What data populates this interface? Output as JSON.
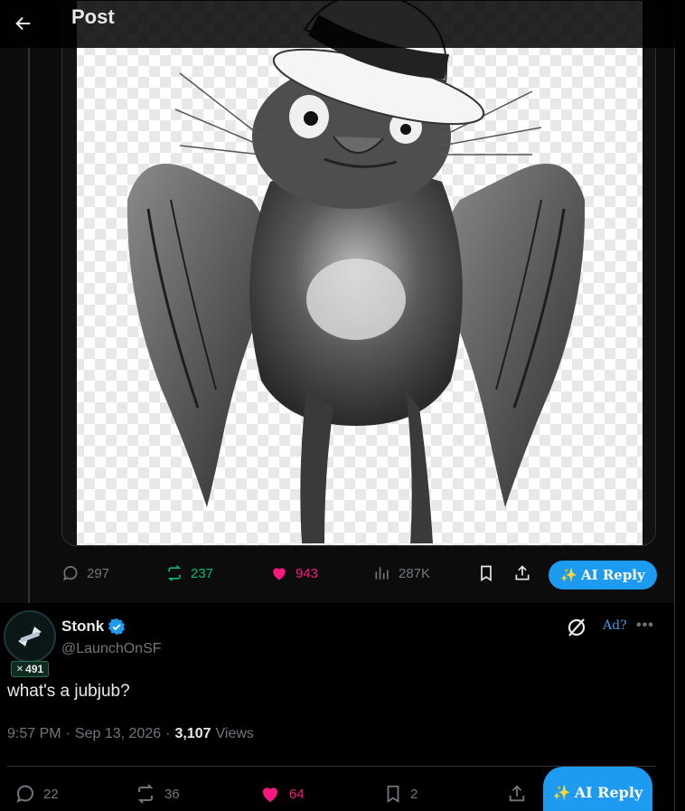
{
  "header": {
    "title": "Post"
  },
  "quoted_post": {
    "actions": {
      "replies": "297",
      "reposts": "237",
      "likes": "943",
      "views": "287K"
    },
    "ai_reply_label": "AI Reply"
  },
  "post": {
    "display_name": "Stonk",
    "handle": "@LaunchOnSF",
    "badge_count": "491",
    "ad_label": "Ad?",
    "text": "what's a jubjub?",
    "time": "9:57 PM",
    "date": "Sep 13, 2026",
    "views_count": "3,107",
    "views_label": "Views",
    "actions": {
      "replies": "22",
      "reposts": "36",
      "likes": "64",
      "bookmarks": "2"
    },
    "ai_reply_label": "AI Reply"
  },
  "colors": {
    "accent": "#1d9bf0",
    "repost_active": "#00ba7c",
    "like_active": "#f91880",
    "muted": "#71767b"
  },
  "icons": [
    "back-arrow-icon",
    "reply-icon",
    "repost-icon",
    "heart-icon",
    "views-icon",
    "bookmark-icon",
    "share-icon",
    "sparkles-icon",
    "verified-icon",
    "grok-icon",
    "more-icon"
  ]
}
